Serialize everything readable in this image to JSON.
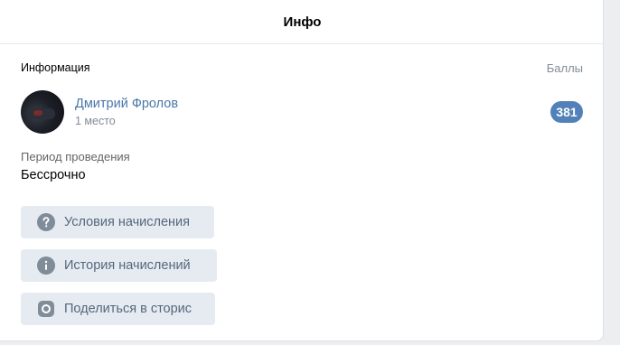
{
  "header": {
    "title": "Инфо"
  },
  "info_section": {
    "label": "Информация",
    "points_label": "Баллы"
  },
  "user": {
    "name": "Дмитрий Фролов",
    "place": "1 место",
    "score": "381"
  },
  "period": {
    "label": "Период проведения",
    "value": "Бессрочно"
  },
  "actions": [
    {
      "label": "Условия начисления",
      "icon": "question-circle-icon"
    },
    {
      "label": "История начислений",
      "icon": "info-circle-icon"
    },
    {
      "label": "Поделиться в сторис",
      "icon": "story-icon"
    }
  ],
  "colors": {
    "accent": "#5181b8",
    "link": "#4a76a8",
    "button_bg": "#e5ebf1",
    "button_text": "#55677d",
    "icon": "#818c99",
    "secondary_text": "#818c99"
  }
}
